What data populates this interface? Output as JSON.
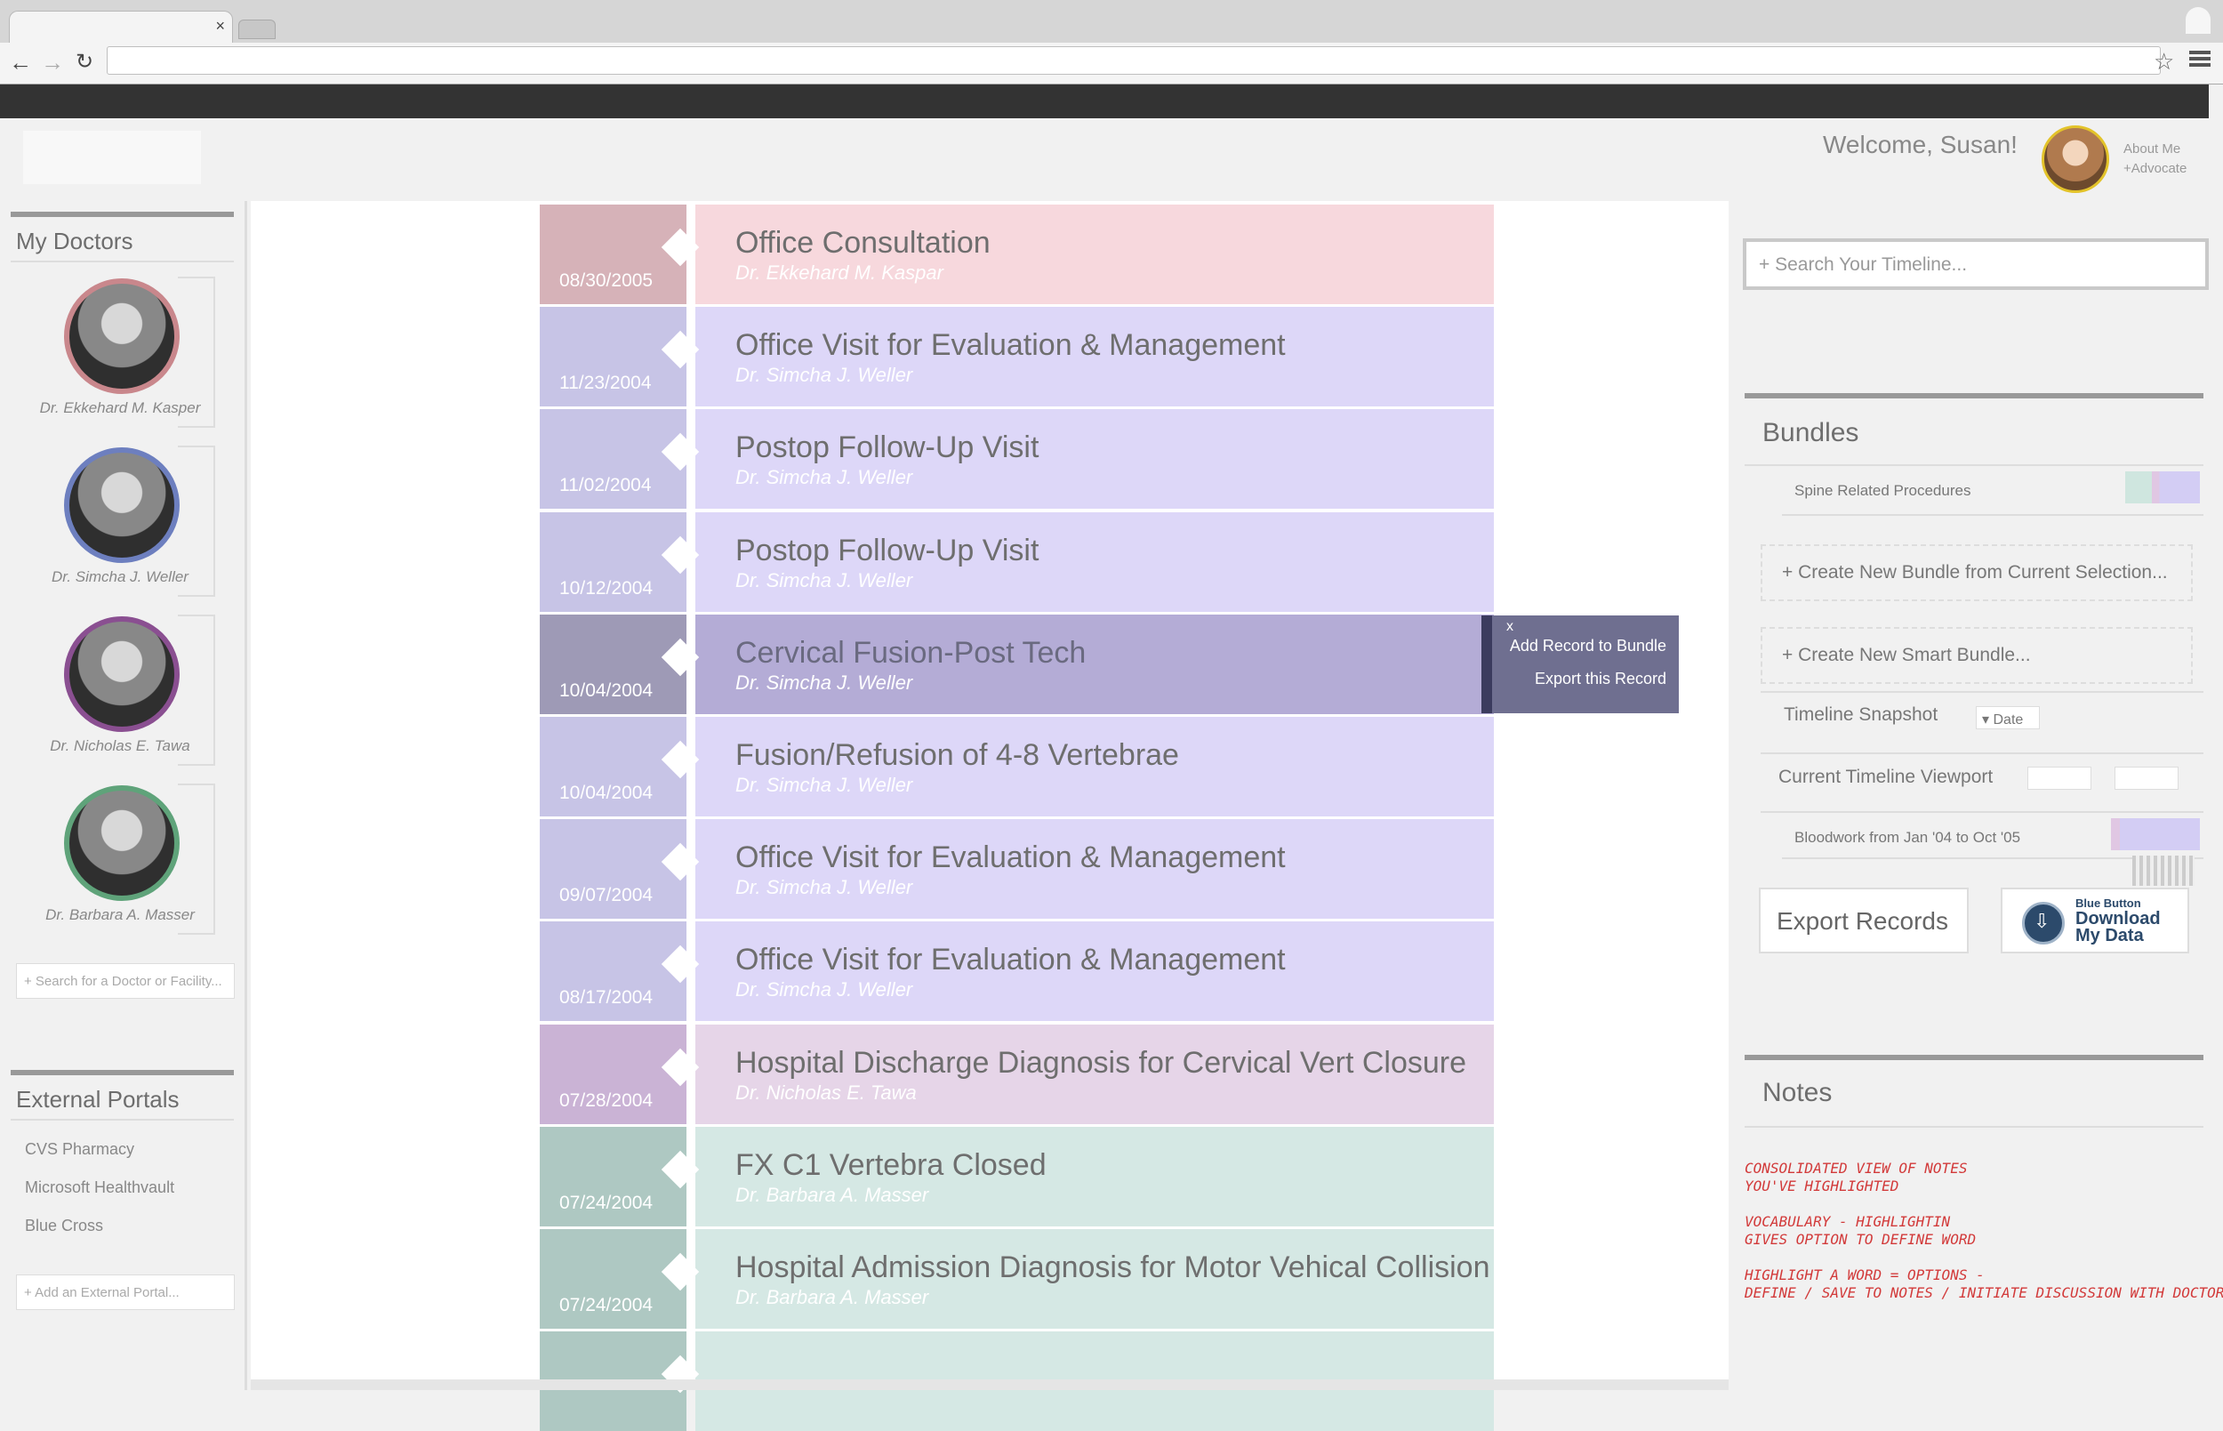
{
  "app": {
    "welcome": "Welcome, Susan!",
    "about_me": "About Me",
    "advocate": "+Advocate",
    "tab_close": "×"
  },
  "icons": {
    "back": "back-arrow-icon",
    "forward": "forward-arrow-icon",
    "reload": "reload-icon",
    "star": "bookmark-star-icon",
    "menu": "hamburger-menu-icon"
  },
  "left": {
    "doctors_title": "My Doctors",
    "doctors": [
      {
        "name": "Dr. Ekkehard M. Kasper",
        "color": "#c9878c"
      },
      {
        "name": "Dr. Simcha J. Weller",
        "color": "#6d7fbf"
      },
      {
        "name": "Dr. Nicholas E. Tawa",
        "color": "#8a4f91"
      },
      {
        "name": "Dr. Barbara A. Masser",
        "color": "#5fa37a"
      }
    ],
    "doctor_search_placeholder": "+ Search for a Doctor or Facility...",
    "portals_title": "External Portals",
    "portals": [
      "CVS Pharmacy",
      "Microsoft Healthvault",
      "Blue Cross"
    ],
    "portal_add_placeholder": "+ Add an External Portal..."
  },
  "timeline": [
    {
      "date": "08/30/2005",
      "title": "Office Consultation",
      "doctor": "Dr. Ekkehard M. Kaspar",
      "tab_color": "#d6b2b8",
      "body_color": "#f7d8dd"
    },
    {
      "date": "11/23/2004",
      "title": "Office Visit for Evaluation & Management",
      "doctor": "Dr. Simcha J. Weller",
      "tab_color": "#c7c4e6",
      "body_color": "#ddd7f8"
    },
    {
      "date": "11/02/2004",
      "title": "Postop Follow-Up Visit",
      "doctor": "Dr. Simcha J. Weller",
      "tab_color": "#c7c4e6",
      "body_color": "#ddd7f8"
    },
    {
      "date": "10/12/2004",
      "title": "Postop Follow-Up Visit",
      "doctor": "Dr. Simcha J. Weller",
      "tab_color": "#c7c4e6",
      "body_color": "#ddd7f8"
    },
    {
      "date": "10/04/2004",
      "title": "Cervical Fusion-Post Tech",
      "doctor": "Dr. Simcha J. Weller",
      "tab_color": "#9e9ab6",
      "body_color": "#b4acd6",
      "selected": true
    },
    {
      "date": "10/04/2004",
      "title": "Fusion/Refusion of 4-8 Vertebrae",
      "doctor": "Dr. Simcha J. Weller",
      "tab_color": "#c7c4e6",
      "body_color": "#ddd7f8"
    },
    {
      "date": "09/07/2004",
      "title": "Office Visit for Evaluation & Management",
      "doctor": "Dr. Simcha J. Weller",
      "tab_color": "#c7c4e6",
      "body_color": "#ddd7f8"
    },
    {
      "date": "08/17/2004",
      "title": "Office Visit for Evaluation & Management",
      "doctor": "Dr. Simcha J. Weller",
      "tab_color": "#c7c4e6",
      "body_color": "#ddd7f8"
    },
    {
      "date": "07/28/2004",
      "title": "Hospital Discharge Diagnosis for Cervical Vert Closure",
      "doctor": "Dr. Nicholas E. Tawa",
      "tab_color": "#cab3d5",
      "body_color": "#e6d5e8"
    },
    {
      "date": "07/24/2004",
      "title": "FX C1 Vertebra Closed",
      "doctor": "Dr. Barbara A. Masser",
      "tab_color": "#aec8c2",
      "body_color": "#d5e8e4"
    },
    {
      "date": "07/24/2004",
      "title": "Hospital Admission Diagnosis for Motor Vehical Collision",
      "doctor": "Dr. Barbara A. Masser",
      "tab_color": "#aec8c2",
      "body_color": "#d5e8e4"
    },
    {
      "date": "",
      "title": "",
      "doctor": "",
      "tab_color": "#aec8c2",
      "body_color": "#d5e8e4"
    }
  ],
  "popup": {
    "close": "x",
    "add_to_bundle": "Add Record to Bundle",
    "export_record": "Export this Record"
  },
  "right": {
    "search_placeholder": "+ Search Your Timeline...",
    "bundles_title": "Bundles",
    "bundle_item": "Spine Related Procedures",
    "create_bundle": "+ Create New Bundle from Current Selection...",
    "create_smart_bundle": "+ Create New Smart Bundle...",
    "snapshot_label": "Timeline Snapshot",
    "snapshot_dropdown": "Date",
    "viewport_label": "Current Timeline Viewport",
    "bloodwork": "Bloodwork from Jan '04 to Oct '05",
    "export_button": "Export Records",
    "bluebutton_small": "Blue Button",
    "bluebutton_big1": "Download",
    "bluebutton_big2": "My Data",
    "notes_title": "Notes",
    "notes_lines": [
      "CONSOLIDATED VIEW OF NOTES",
      "YOU'VE HIGHLIGHTED",
      "VOCABULARY - HIGHLIGHTIN",
      "GIVES OPTION TO DEFINE WORD",
      "HIGHLIGHT A WORD = OPTIONS -",
      "DEFINE / SAVE TO NOTES / INITIATE DISCUSSION WITH DOCTOR"
    ]
  }
}
